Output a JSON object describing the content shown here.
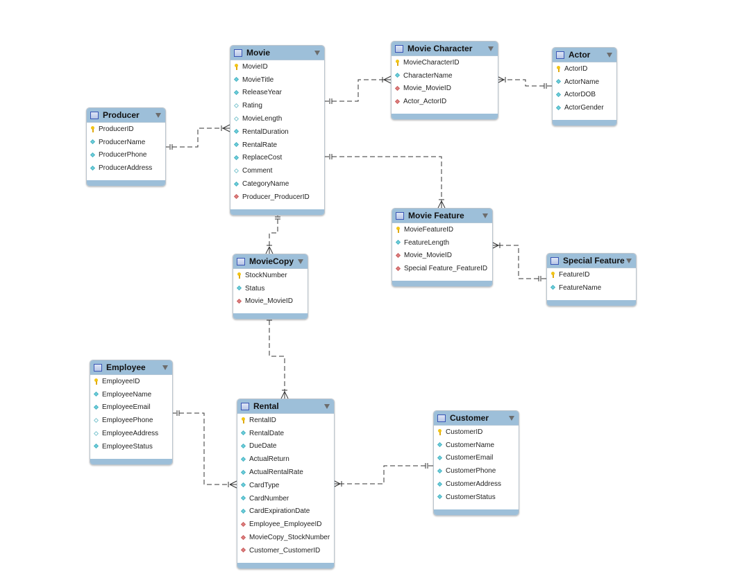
{
  "tables": [
    {
      "id": "movie",
      "name": "Movie",
      "columns": [
        {
          "name": "MovieID",
          "type": "key"
        },
        {
          "name": "MovieTitle",
          "type": "nn"
        },
        {
          "name": "ReleaseYear",
          "type": "nn"
        },
        {
          "name": "Rating",
          "type": "null"
        },
        {
          "name": "MovieLength",
          "type": "null"
        },
        {
          "name": "RentalDuration",
          "type": "nn"
        },
        {
          "name": "RentalRate",
          "type": "nn"
        },
        {
          "name": "ReplaceCost",
          "type": "nn"
        },
        {
          "name": "Comment",
          "type": "null"
        },
        {
          "name": "CategoryName",
          "type": "nn"
        },
        {
          "name": "Producer_ProducerID",
          "type": "fk"
        }
      ]
    },
    {
      "id": "moviecharacter",
      "name": "Movie Character",
      "columns": [
        {
          "name": "MovieCharacterID",
          "type": "key"
        },
        {
          "name": "CharacterName",
          "type": "nn"
        },
        {
          "name": "Movie_MovieID",
          "type": "fk"
        },
        {
          "name": "Actor_ActorID",
          "type": "fk"
        }
      ]
    },
    {
      "id": "actor",
      "name": "Actor",
      "columns": [
        {
          "name": "ActorID",
          "type": "key"
        },
        {
          "name": "ActorName",
          "type": "nn"
        },
        {
          "name": "ActorDOB",
          "type": "nn"
        },
        {
          "name": "ActorGender",
          "type": "nn"
        }
      ]
    },
    {
      "id": "producer",
      "name": "Producer",
      "columns": [
        {
          "name": "ProducerID",
          "type": "key"
        },
        {
          "name": "ProducerName",
          "type": "nn"
        },
        {
          "name": "ProducerPhone",
          "type": "nn"
        },
        {
          "name": "ProducerAddress",
          "type": "nn"
        }
      ]
    },
    {
      "id": "moviecopy",
      "name": "MovieCopy",
      "columns": [
        {
          "name": "StockNumber",
          "type": "key"
        },
        {
          "name": "Status",
          "type": "nn"
        },
        {
          "name": "Movie_MovieID",
          "type": "fk"
        }
      ]
    },
    {
      "id": "moviefeature",
      "name": "Movie Feature",
      "columns": [
        {
          "name": "MovieFeatureID",
          "type": "key"
        },
        {
          "name": "FeatureLength",
          "type": "nn"
        },
        {
          "name": "Movie_MovieID",
          "type": "fk"
        },
        {
          "name": "Special Feature_FeatureID",
          "type": "fk"
        }
      ]
    },
    {
      "id": "specialfeature",
      "name": "Special Feature",
      "columns": [
        {
          "name": "FeatureID",
          "type": "key"
        },
        {
          "name": "FeatureName",
          "type": "nn"
        }
      ]
    },
    {
      "id": "employee",
      "name": "Employee",
      "columns": [
        {
          "name": "EmployeeID",
          "type": "key"
        },
        {
          "name": "EmployeeName",
          "type": "nn"
        },
        {
          "name": "EmployeeEmail",
          "type": "nn"
        },
        {
          "name": "EmployeePhone",
          "type": "null"
        },
        {
          "name": "EmployeeAddress",
          "type": "null"
        },
        {
          "name": "EmployeeStatus",
          "type": "nn"
        }
      ]
    },
    {
      "id": "rental",
      "name": "Rental",
      "columns": [
        {
          "name": "RentalID",
          "type": "key"
        },
        {
          "name": "RentalDate",
          "type": "nn"
        },
        {
          "name": "DueDate",
          "type": "nn"
        },
        {
          "name": "ActualReturn",
          "type": "nn"
        },
        {
          "name": "ActualRentalRate",
          "type": "nn"
        },
        {
          "name": "CardType",
          "type": "nn"
        },
        {
          "name": "CardNumber",
          "type": "nn"
        },
        {
          "name": "CardExpirationDate",
          "type": "nn"
        },
        {
          "name": "Employee_EmployeeID",
          "type": "fk"
        },
        {
          "name": "MovieCopy_StockNumber",
          "type": "fk"
        },
        {
          "name": "Customer_CustomerID",
          "type": "fk"
        }
      ]
    },
    {
      "id": "customer",
      "name": "Customer",
      "columns": [
        {
          "name": "CustomerID",
          "type": "key"
        },
        {
          "name": "CustomerName",
          "type": "nn"
        },
        {
          "name": "CustomerEmail",
          "type": "nn"
        },
        {
          "name": "CustomerPhone",
          "type": "nn"
        },
        {
          "name": "CustomerAddress",
          "type": "nn"
        },
        {
          "name": "CustomerStatus",
          "type": "nn"
        }
      ]
    }
  ],
  "relationships": [
    {
      "one": "Producer",
      "many": "Movie"
    },
    {
      "one": "Movie",
      "many": "Movie Character"
    },
    {
      "one": "Actor",
      "many": "Movie Character"
    },
    {
      "one": "Movie",
      "many": "Movie Feature"
    },
    {
      "one": "Special Feature",
      "many": "Movie Feature"
    },
    {
      "one": "Movie",
      "many": "MovieCopy"
    },
    {
      "one": "MovieCopy",
      "many": "Rental"
    },
    {
      "one": "Employee",
      "many": "Rental"
    },
    {
      "one": "Customer",
      "many": "Rental"
    }
  ],
  "colors": {
    "header": "#9dbfd9",
    "key": "#f2c515",
    "not_null": "#6fd0dc",
    "foreign_key": "#e08080",
    "line": "#333333"
  }
}
